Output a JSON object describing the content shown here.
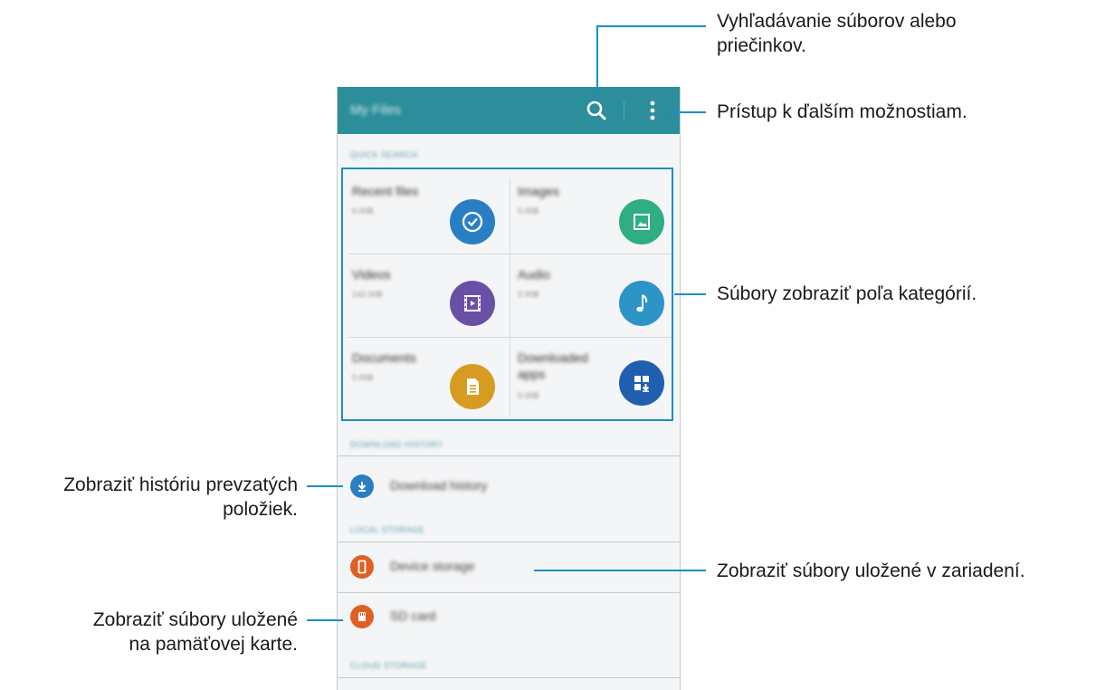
{
  "app": {
    "title": "My Files"
  },
  "sections": {
    "quick_search": "QUICK SEARCH",
    "download_history": "DOWNLOAD HISTORY",
    "local_storage": "LOCAL STORAGE",
    "cloud_storage": "CLOUD STORAGE"
  },
  "categories": [
    {
      "name": "Recent files",
      "size": "0.00B",
      "icon": "clock-icon",
      "color": "#2a7fc4"
    },
    {
      "name": "Images",
      "size": "0.00B",
      "icon": "image-icon",
      "color": "#2fae82"
    },
    {
      "name": "Videos",
      "size": "142.00B",
      "icon": "film-icon",
      "color": "#6a4fa6"
    },
    {
      "name": "Audio",
      "size": "0.00B",
      "icon": "music-note-icon",
      "color": "#2d94c8"
    },
    {
      "name": "Documents",
      "size": "0.00B",
      "icon": "document-icon",
      "color": "#d79b22"
    },
    {
      "name": "Downloaded apps",
      "size": "0.00B",
      "icon": "apps-download-icon",
      "color": "#1f5fae"
    }
  ],
  "download_history": {
    "label": "Download history",
    "color": "#2a7fc4"
  },
  "storage": [
    {
      "label": "Device storage",
      "icon": "phone-icon",
      "color": "#df5f25"
    },
    {
      "label": "SD card",
      "icon": "sd-card-icon",
      "color": "#df5f25"
    }
  ],
  "callouts": {
    "search": "Vyhľadávanie súborov alebo priečinkov.",
    "search_l1": "Vyhľadávanie súborov alebo",
    "search_l2": "priečinkov.",
    "more": "Prístup k ďalším možnostiam.",
    "categories": "Súbory zobraziť poľa kategórií.",
    "history_l1": "Zobraziť históriu prevzatých",
    "history_l2": "položiek.",
    "device": "Zobraziť súbory uložené v zariadení.",
    "sd_l1": "Zobraziť súbory uložené",
    "sd_l2": "na pamäťovej karte."
  },
  "colors": {
    "accent": "#1b8fc2",
    "appbar": "#2c8d9b"
  }
}
